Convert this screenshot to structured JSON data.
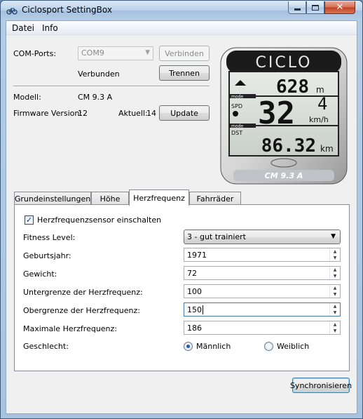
{
  "window": {
    "title": "Ciclosport SettingBox"
  },
  "menu": {
    "items": [
      {
        "label": "Datei"
      },
      {
        "label": "Info"
      }
    ]
  },
  "connection": {
    "com_label": "COM-Ports:",
    "com_value": "COM9",
    "connect_button": "Verbinden",
    "status": "Verbunden",
    "disconnect_button": "Trennen"
  },
  "device_info": {
    "model_label": "Modell:",
    "model_value": "CM 9.3 A",
    "firmware_label": "Firmware Version:",
    "firmware_value": "12",
    "current_label": "Aktuell:",
    "current_value": "14",
    "update_button": "Update"
  },
  "device_image": {
    "brand": "CICLO",
    "altitude": "628",
    "altitude_unit": "m",
    "speed": "32",
    "speed_decimal": "4",
    "speed_unit": "km/h",
    "distance": "86.32",
    "distance_unit": "km",
    "mode1": "mode",
    "mode2": "mode",
    "spd": "SPD",
    "dst": "DST",
    "model_badge": "CM 9.3 A"
  },
  "tabs": [
    {
      "label": "Grundeinstellungen"
    },
    {
      "label": "Höhe"
    },
    {
      "label": "Herzfrequenz"
    },
    {
      "label": "Fahrräder"
    }
  ],
  "heartrate": {
    "sensor_label": "Herzfrequenzsensor einschalten",
    "sensor_checked": true,
    "fitness_label": "Fitness Level:",
    "fitness_value": "3 - gut trainiert",
    "birth_label": "Geburtsjahr:",
    "birth_value": "1971",
    "weight_label": "Gewicht:",
    "weight_value": "72",
    "lower_label": "Untergrenze der Herzfrequenz:",
    "lower_value": "100",
    "upper_label": "Obergrenze der Herzfrequenz:",
    "upper_value": "150",
    "max_label": "Maximale Herzfrequenz:",
    "max_value": "186",
    "gender_label": "Geschlecht:",
    "male_label": "Männlich",
    "female_label": "Weiblich",
    "selected_gender": "Männlich"
  },
  "footer": {
    "sync_button": "Synchronisieren"
  }
}
